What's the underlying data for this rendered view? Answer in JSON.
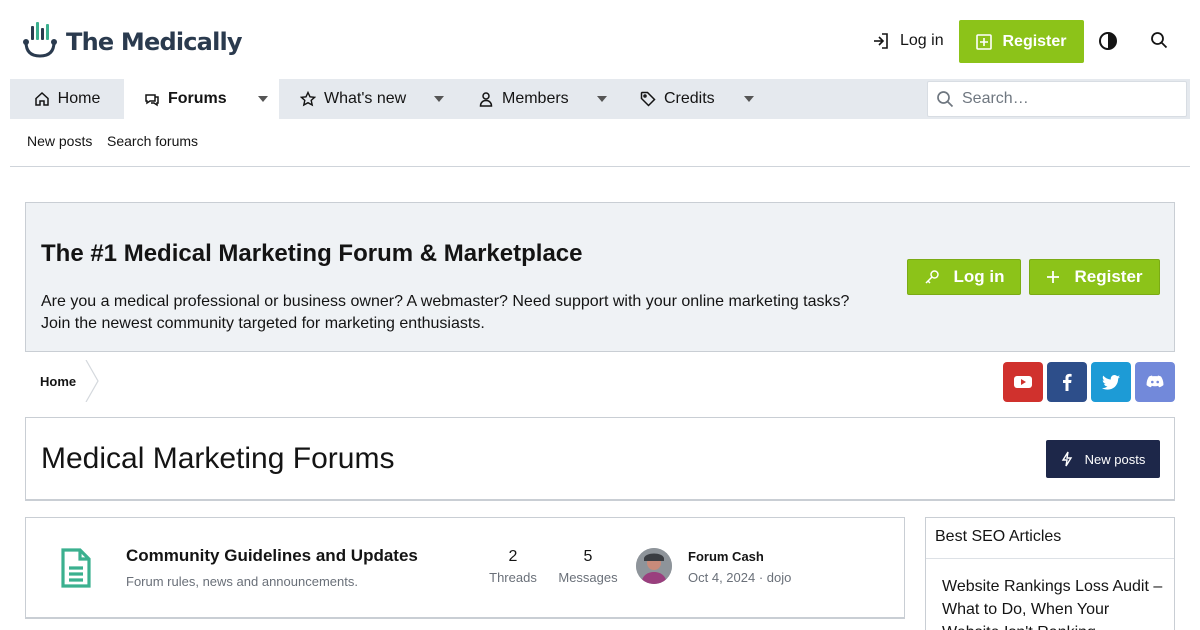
{
  "header": {
    "logo_text": "The Medically",
    "login_label": "Log in",
    "register_label": "Register"
  },
  "nav": {
    "items": [
      {
        "label": "Home",
        "icon": "home-icon"
      },
      {
        "label": "Forums",
        "icon": "chat-icon",
        "active": true
      },
      {
        "label": "What's new",
        "icon": "star-icon"
      },
      {
        "label": "Members",
        "icon": "user-icon"
      },
      {
        "label": "Credits",
        "icon": "tag-icon"
      }
    ],
    "search_placeholder": "Search…"
  },
  "subnav": {
    "items": [
      "New posts",
      "Search forums"
    ]
  },
  "notice": {
    "title": "The #1 Medical Marketing Forum & Marketplace",
    "text": "Are you a medical professional or business owner? A webmaster? Need support with your online marketing tasks? Join the newest community targeted for marketing enthusiasts.",
    "login_label": "Log in",
    "register_label": "Register"
  },
  "breadcrumb": {
    "items": [
      "Home"
    ]
  },
  "social": [
    {
      "name": "youtube",
      "color": "#d0312d"
    },
    {
      "name": "facebook",
      "color": "#2d4e8a"
    },
    {
      "name": "twitter",
      "color": "#1d9bd6"
    },
    {
      "name": "discord",
      "color": "#7289da"
    }
  ],
  "page": {
    "title": "Medical Marketing Forums",
    "new_posts_label": "New posts"
  },
  "forum_nodes": [
    {
      "title": "Community Guidelines and Updates",
      "description": "Forum rules, news and announcements.",
      "threads_count": "2",
      "threads_label": "Threads",
      "messages_count": "5",
      "messages_label": "Messages",
      "last_post_title": "Forum Cash",
      "last_post_meta": "Oct 4, 2024 · dojo"
    }
  ],
  "sidebar": {
    "heading": "Best SEO Articles",
    "link": "Website Rankings Loss Audit – What to Do, When Your Website Isn't Ranking"
  },
  "colors": {
    "accent_green": "#8cc319",
    "nav_bg": "#e5e9ee",
    "dark_button": "#1d2749",
    "node_icon": "#3bb08f"
  }
}
